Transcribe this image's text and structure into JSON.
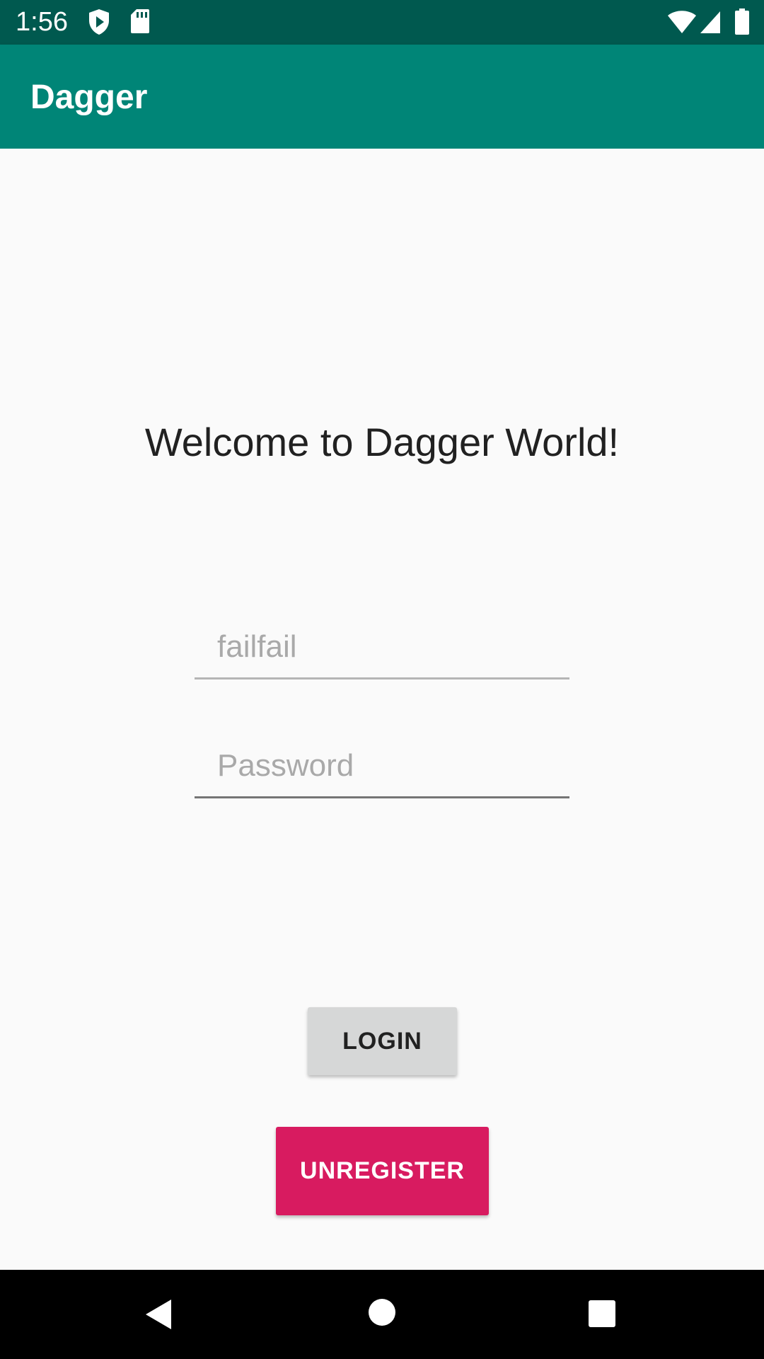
{
  "status_bar": {
    "time": "1:56",
    "background": "#00594f",
    "icons": [
      "shield-play-icon",
      "sd-card-icon",
      "wifi-icon",
      "cell-signal-icon",
      "battery-icon"
    ]
  },
  "app_bar": {
    "title": "Dagger",
    "background": "#008577"
  },
  "main": {
    "welcome_text": "Welcome to Dagger World!",
    "username_field": {
      "value": "",
      "placeholder": "failfail"
    },
    "password_field": {
      "value": "",
      "placeholder": "Password"
    },
    "login_button": {
      "label": "LOGIN",
      "background": "#d6d7d7"
    },
    "unregister_button": {
      "label": "UNREGISTER",
      "background": "#d81b60"
    }
  },
  "nav_bar": {
    "icons": [
      "back-icon",
      "home-icon",
      "recents-icon"
    ]
  }
}
